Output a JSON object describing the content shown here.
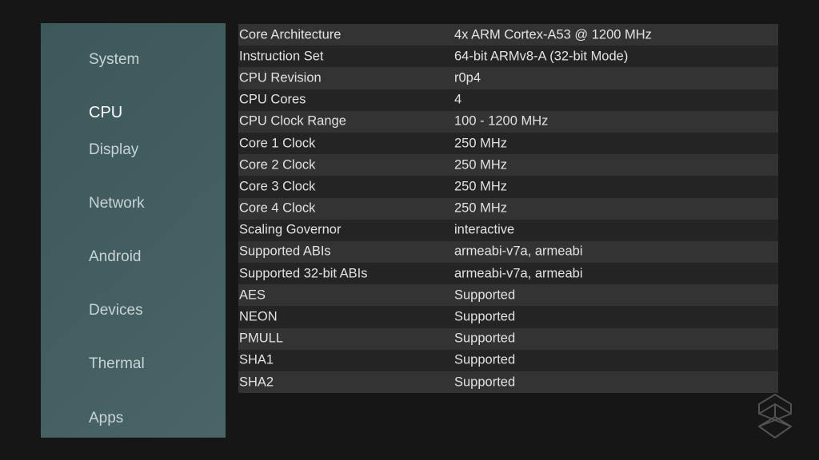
{
  "sidebar": {
    "items": [
      {
        "label": "System"
      },
      {
        "label": "CPU",
        "active": true
      },
      {
        "label": "Display"
      },
      {
        "label": "Network"
      },
      {
        "label": "Android"
      },
      {
        "label": "Devices"
      },
      {
        "label": "Thermal"
      },
      {
        "label": "Apps"
      }
    ]
  },
  "cpu_info": {
    "rows": [
      {
        "label": "Core Architecture",
        "value": "4x ARM Cortex-A53 @ 1200 MHz"
      },
      {
        "label": "Instruction Set",
        "value": "64-bit ARMv8-A (32-bit Mode)"
      },
      {
        "label": "CPU Revision",
        "value": "r0p4"
      },
      {
        "label": "CPU Cores",
        "value": "4"
      },
      {
        "label": "CPU Clock Range",
        "value": "100 - 1200 MHz"
      },
      {
        "label": "Core 1 Clock",
        "value": "250 MHz"
      },
      {
        "label": "Core 2 Clock",
        "value": "250 MHz"
      },
      {
        "label": "Core 3 Clock",
        "value": "250 MHz"
      },
      {
        "label": "Core 4 Clock",
        "value": "250 MHz"
      },
      {
        "label": "Scaling Governor",
        "value": "interactive"
      },
      {
        "label": "Supported ABIs",
        "value": "armeabi-v7a, armeabi"
      },
      {
        "label": "Supported 32-bit ABIs",
        "value": "armeabi-v7a, armeabi"
      },
      {
        "label": "AES",
        "value": "Supported"
      },
      {
        "label": "NEON",
        "value": "Supported"
      },
      {
        "label": "PMULL",
        "value": "Supported"
      },
      {
        "label": "SHA1",
        "value": "Supported"
      },
      {
        "label": "SHA2",
        "value": "Supported"
      }
    ]
  },
  "watermark": {
    "icon": "site-logo-icon"
  },
  "colors": {
    "sidebar": "#425d60",
    "row_odd": "#333333",
    "row_even": "#242424",
    "background": "#161616"
  }
}
